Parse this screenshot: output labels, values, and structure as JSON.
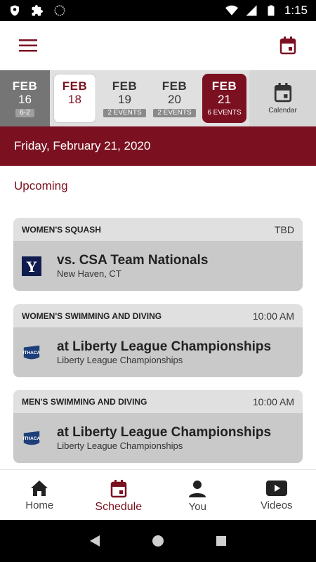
{
  "status_bar": {
    "time": "1:15"
  },
  "date_strip": {
    "days": [
      {
        "month": "FEB",
        "day": "16",
        "badge": "6-2"
      },
      {
        "month": "FEB",
        "day": "18",
        "badge": ""
      },
      {
        "month": "FEB",
        "day": "19",
        "badge": "2 EVENTS"
      },
      {
        "month": "FEB",
        "day": "20",
        "badge": "2 EVENTS"
      },
      {
        "month": "FEB",
        "day": "21",
        "badge": "6 EVENTS"
      }
    ],
    "calendar_label": "Calendar"
  },
  "selected_date": "Friday, February 21, 2020",
  "section_title": "Upcoming",
  "events": [
    {
      "sport": "WOMEN'S SQUASH",
      "time": "TBD",
      "title": "vs. CSA Team Nationals",
      "location": "New Haven, CT",
      "logo": "yale-logo"
    },
    {
      "sport": "WOMEN'S SWIMMING AND DIVING",
      "time": "10:00 AM",
      "title": "at Liberty League Championships",
      "location": "Liberty League Championships",
      "logo": "ithaca-logo"
    },
    {
      "sport": "MEN'S SWIMMING AND DIVING",
      "time": "10:00 AM",
      "title": "at Liberty League Championships",
      "location": "Liberty League Championships",
      "logo": "ithaca-logo"
    }
  ],
  "bottom_nav": [
    {
      "label": "Home",
      "icon": "home-icon"
    },
    {
      "label": "Schedule",
      "icon": "calendar-icon"
    },
    {
      "label": "You",
      "icon": "person-icon"
    },
    {
      "label": "Videos",
      "icon": "video-icon"
    }
  ],
  "colors": {
    "brand": "#7b1120"
  }
}
